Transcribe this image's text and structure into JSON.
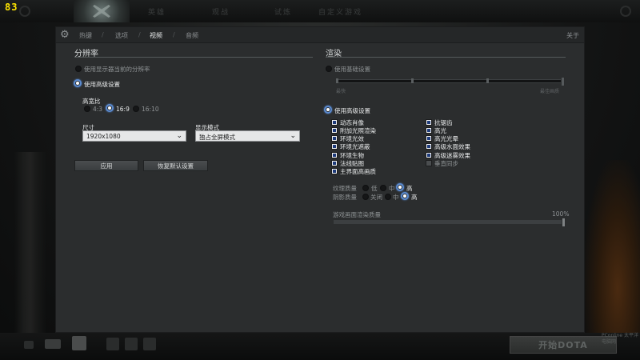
{
  "fps": "83",
  "topnav": [
    "英雄",
    "观战",
    "试炼",
    "自定义游戏"
  ],
  "tabs": [
    {
      "label": "热键",
      "active": false
    },
    {
      "label": "选项",
      "active": false
    },
    {
      "label": "视频",
      "active": true
    },
    {
      "label": "音频",
      "active": false
    }
  ],
  "about_label": "关于",
  "resolution": {
    "title": "分辨率",
    "use_monitor_label": "使用显示器当前的分辨率",
    "use_advanced_label": "使用高级设置",
    "aspect_label": "高宽比",
    "aspects": [
      {
        "label": "4:3",
        "selected": false
      },
      {
        "label": "16:9",
        "selected": true
      },
      {
        "label": "16:10",
        "selected": false
      }
    ],
    "size_label": "尺寸",
    "size_value": "1920x1080",
    "display_mode_label": "显示模式",
    "display_mode_value": "独占全屏模式",
    "apply_label": "应用",
    "restore_label": "恢复默认设置"
  },
  "render": {
    "title": "渲染",
    "use_basic_label": "使用基础设置",
    "basic_slider_min": "最快",
    "basic_slider_max": "最佳画质",
    "use_advanced_label": "使用高级设置",
    "left_options": [
      {
        "label": "动态肖像",
        "checked": true
      },
      {
        "label": "附加光照渲染",
        "checked": true
      },
      {
        "label": "环境光效",
        "checked": true
      },
      {
        "label": "环境光遮蔽",
        "checked": true
      },
      {
        "label": "环境生物",
        "checked": true
      },
      {
        "label": "法线贴图",
        "checked": true
      },
      {
        "label": "主界面高画质",
        "checked": true
      }
    ],
    "right_options": [
      {
        "label": "抗锯齿",
        "checked": true
      },
      {
        "label": "高光",
        "checked": true
      },
      {
        "label": "高光光晕",
        "checked": true
      },
      {
        "label": "高级水面效果",
        "checked": true
      },
      {
        "label": "高级迷雾效果",
        "checked": true
      },
      {
        "label": "垂直同步",
        "checked": false
      }
    ],
    "texture_quality_label": "纹理质量",
    "texture_options": [
      {
        "label": "低",
        "selected": false
      },
      {
        "label": "中",
        "selected": false
      },
      {
        "label": "高",
        "selected": true
      }
    ],
    "shadow_quality_label": "阴影质量",
    "shadow_options": [
      {
        "label": "关闭",
        "selected": false
      },
      {
        "label": "中",
        "selected": false
      },
      {
        "label": "高",
        "selected": true
      }
    ],
    "render_quality_label": "游戏画面渲染质量",
    "render_quality_value": "100%",
    "render_quality_fraction": 1.0
  },
  "start_button_label": "开始DOTA",
  "watermark": "PConline 太平洋电脑网",
  "colors": {
    "accent": "#5a8ad0",
    "panel": "#2b2d2e"
  }
}
